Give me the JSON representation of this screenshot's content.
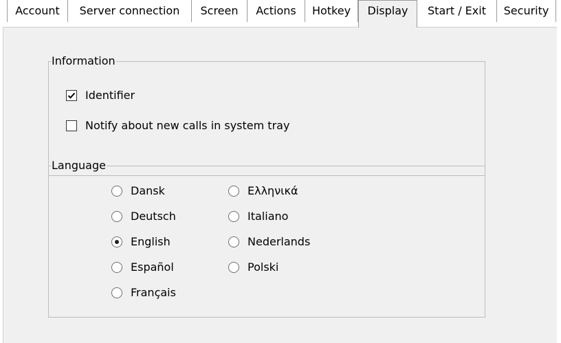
{
  "tabs": [
    {
      "label": "Account",
      "selected": false
    },
    {
      "label": "Server connection",
      "selected": false
    },
    {
      "label": "Screen",
      "selected": false
    },
    {
      "label": "Actions",
      "selected": false
    },
    {
      "label": "Hotkey",
      "selected": false
    },
    {
      "label": "Display",
      "selected": true
    },
    {
      "label": "Start / Exit",
      "selected": false
    },
    {
      "label": "Security",
      "selected": false
    }
  ],
  "information": {
    "title": "Information",
    "identifier": {
      "label": "Identifier",
      "checked": true
    },
    "notify": {
      "label": "Notify about new calls in system tray",
      "checked": false
    }
  },
  "language": {
    "title": "Language",
    "selected": "English",
    "options": [
      "Dansk",
      "Deutsch",
      "English",
      "Español",
      "Français",
      "Ελληνικά",
      "Italiano",
      "Nederlands",
      "Polski"
    ]
  }
}
